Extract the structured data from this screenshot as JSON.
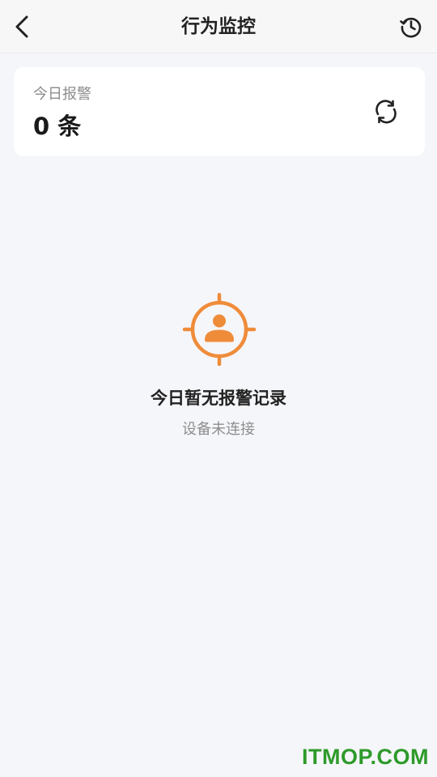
{
  "header": {
    "title": "行为监控",
    "back_icon": "chevron-left-icon",
    "history_icon": "history-clock-icon"
  },
  "summary": {
    "label": "今日报警",
    "count": "0 条",
    "refresh_icon": "refresh-icon"
  },
  "empty_state": {
    "icon": "target-person-icon",
    "title": "今日暂无报警记录",
    "subtitle": "设备未连接"
  },
  "watermark": "ITMOP.COM",
  "colors": {
    "accent": "#ef8c3a",
    "background": "#f5f6fa",
    "card": "#ffffff",
    "watermark": "#2e9a2a"
  }
}
